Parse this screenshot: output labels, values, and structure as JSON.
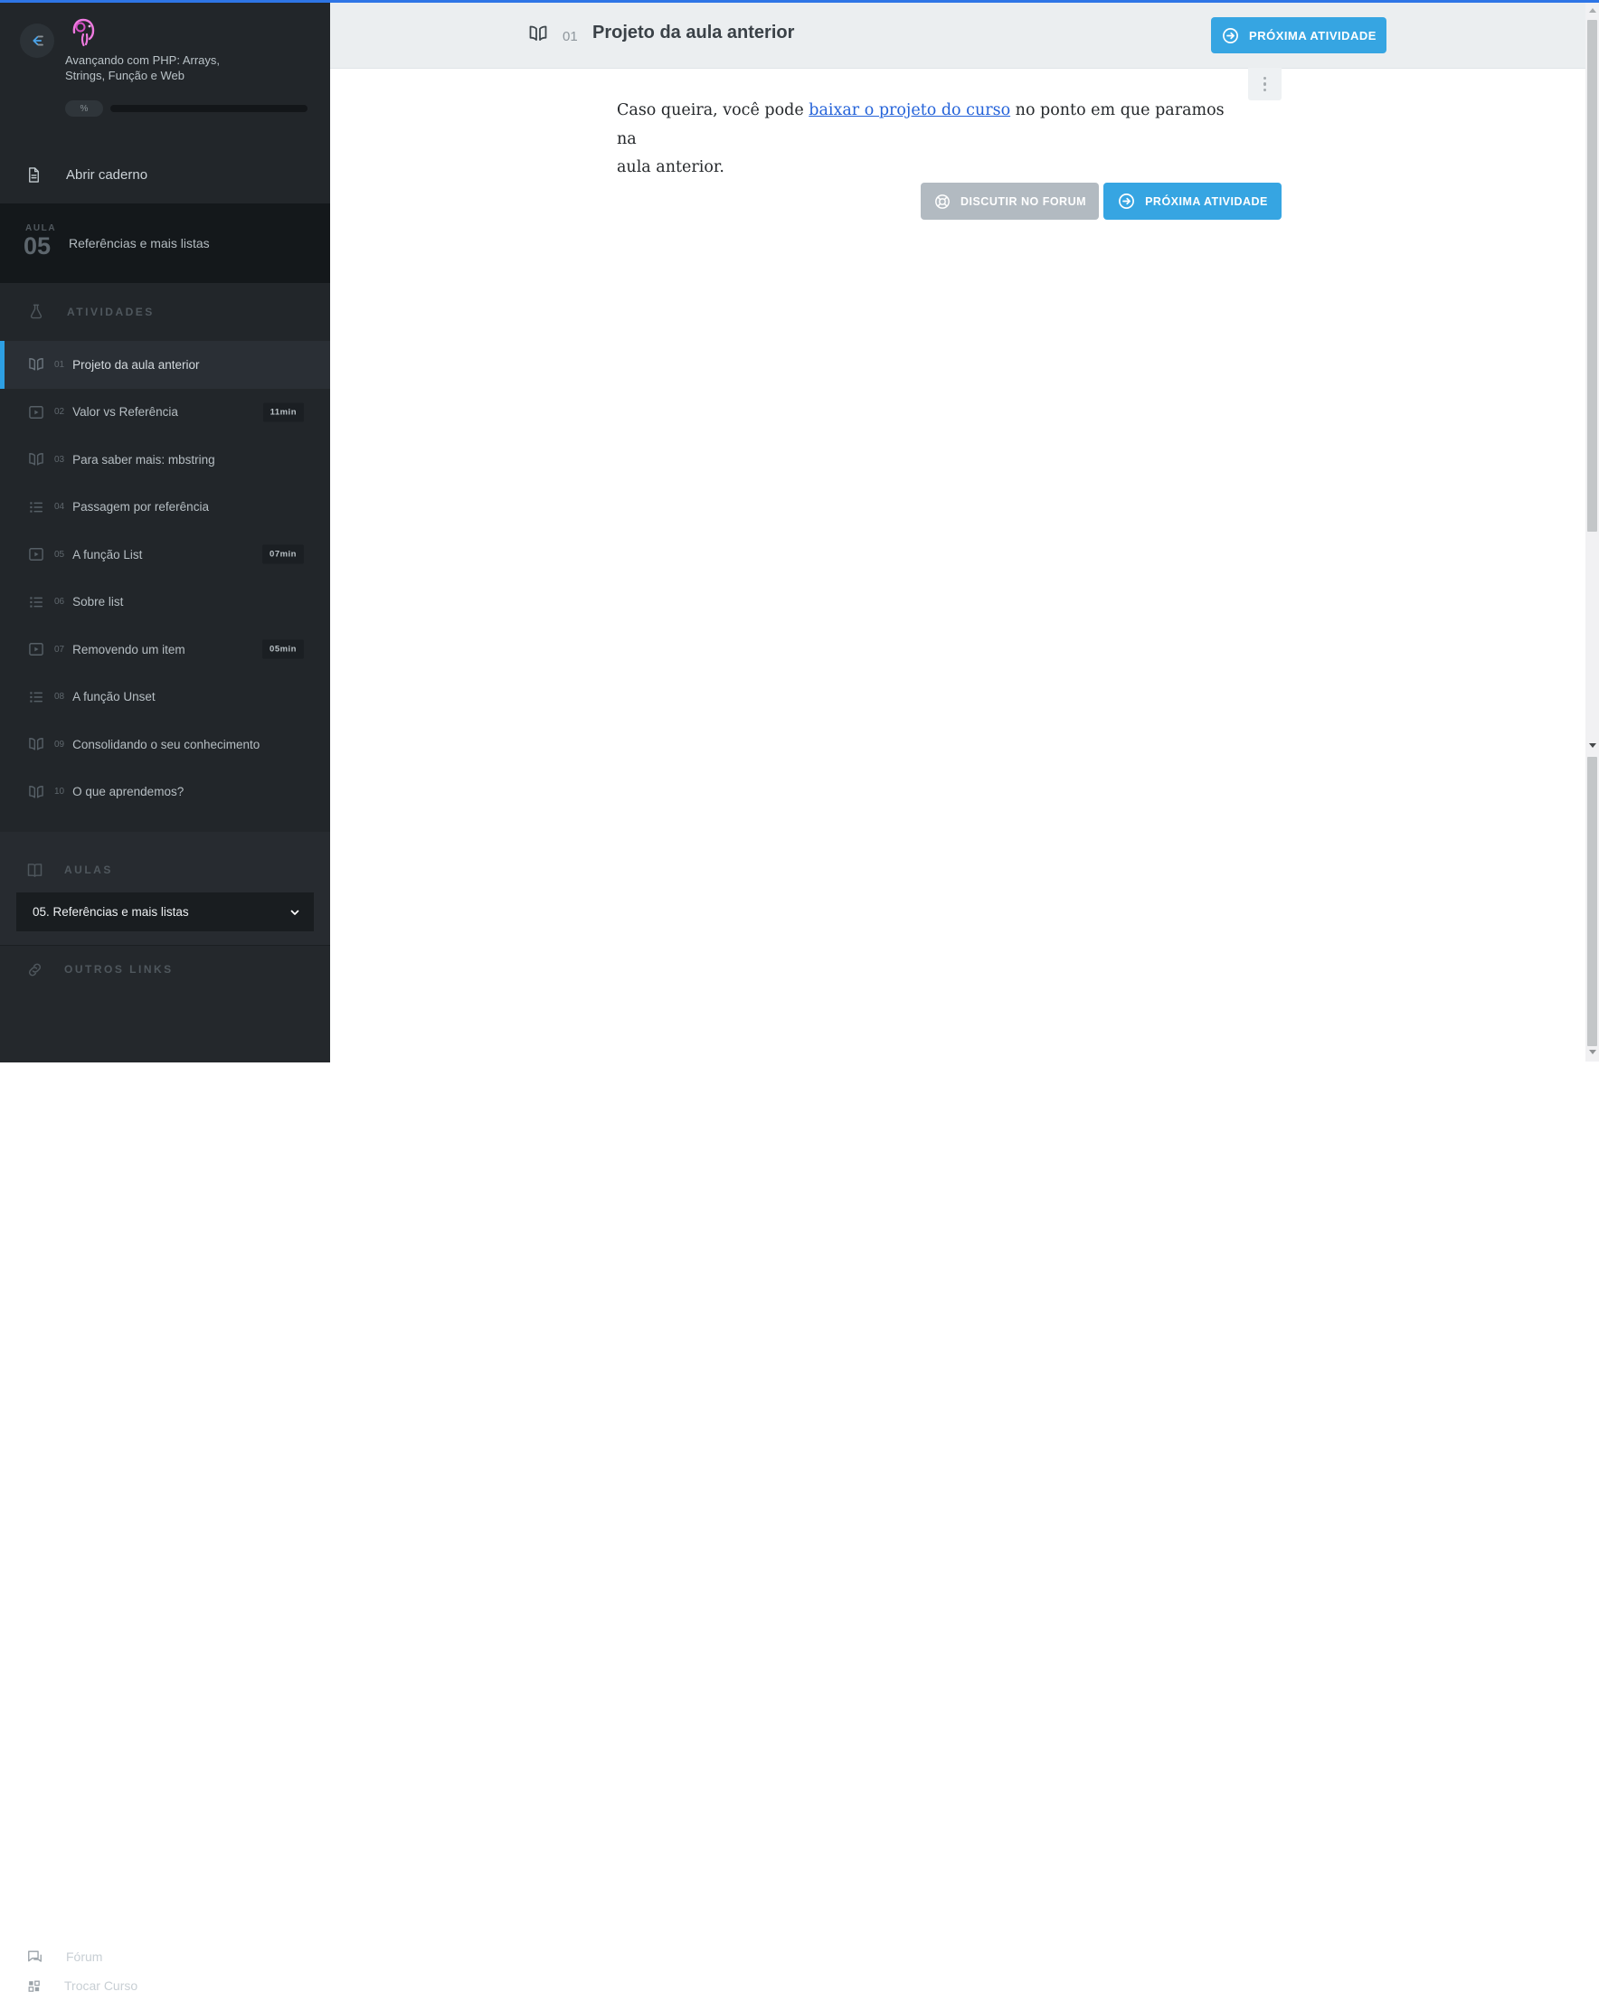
{
  "theme": {
    "accent_blue": "#36a5e2",
    "top_line_blue": "#2e75e6",
    "link_blue": "#2563d9",
    "sidebar_bg": "#22262a",
    "lesson_banner_bg": "#14181b",
    "header_bg": "#ebeef0",
    "logo_pink": "#ef7ae0"
  },
  "sidebar": {
    "collapse_icon": "collapse-sidebar-icon",
    "logo_icon": "php-elephant-icon",
    "course_title_line1": "Avançando com PHP: Arrays,",
    "course_title_line2": "Strings, Função e Web",
    "progress_label": "%",
    "notebook_label": "Abrir caderno",
    "lesson_kicker": "AULA",
    "lesson_number": "05",
    "lesson_title": "Referências e mais listas",
    "activities_header": "ATIVIDADES",
    "activities": [
      {
        "num": "01",
        "label": "Projeto da aula anterior",
        "icon": "book-open-icon",
        "active": true
      },
      {
        "num": "02",
        "label": "Valor vs Referência",
        "icon": "video-icon",
        "duration": "11min"
      },
      {
        "num": "03",
        "label": "Para saber mais: mbstring",
        "icon": "book-open-icon"
      },
      {
        "num": "04",
        "label": "Passagem por referência",
        "icon": "list-icon"
      },
      {
        "num": "05",
        "label": "A função List",
        "icon": "video-icon",
        "duration": "07min"
      },
      {
        "num": "06",
        "label": "Sobre list",
        "icon": "list-icon"
      },
      {
        "num": "07",
        "label": "Removendo um item",
        "icon": "video-icon",
        "duration": "05min"
      },
      {
        "num": "08",
        "label": "A função Unset",
        "icon": "list-icon"
      },
      {
        "num": "09",
        "label": "Consolidando o seu conhecimento",
        "icon": "book-open-icon"
      },
      {
        "num": "10",
        "label": "O que aprendemos?",
        "icon": "book-open-icon"
      }
    ],
    "aulas_header": "AULAS",
    "lesson_select_value": "05. Referências e mais listas",
    "other_links_header": "OUTROS LINKS",
    "forum_label": "Fórum",
    "switch_course_label": "Trocar Curso"
  },
  "header": {
    "activity_number": "01",
    "title": "Projeto da aula anterior",
    "next_button_label": "PRÓXIMA ATIVIDADE"
  },
  "content": {
    "paragraph_before_link": "Caso queira, você pode ",
    "link_text": "baixar o projeto do curso",
    "paragraph_after_link": " no ponto em que paramos na",
    "paragraph_line2": "aula anterior.",
    "forum_button_label": "DISCUTIR NO FORUM",
    "next_button_label": "PRÓXIMA ATIVIDADE"
  }
}
